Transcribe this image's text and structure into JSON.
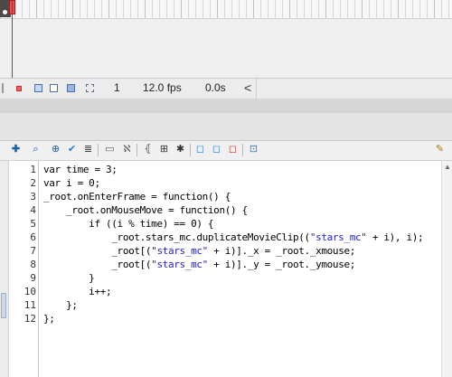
{
  "timeline": {
    "frame": "1",
    "fps": "12.0 fps",
    "time": "0.0s",
    "scroll_left": "<"
  },
  "actions": {
    "lines": [
      {
        "num": "1",
        "code": "var time = 3;"
      },
      {
        "num": "2",
        "code": "var i = 0;"
      },
      {
        "num": "3",
        "code": "_root.onEnterFrame = function() {"
      },
      {
        "num": "4",
        "code": "    _root.onMouseMove = function() {"
      },
      {
        "num": "5",
        "code": "        if ((i % time) == 0) {"
      },
      {
        "num": "6",
        "code": "            _root.stars_mc.duplicateMovieClip((\"stars_mc\" + i), i);"
      },
      {
        "num": "7",
        "code": "            _root[(\"stars_mc\" + i)]._x = _root._xmouse;"
      },
      {
        "num": "8",
        "code": "            _root[(\"stars_mc\" + i)]._y = _root._ymouse;"
      },
      {
        "num": "9",
        "code": "        }"
      },
      {
        "num": "10",
        "code": "        i++;"
      },
      {
        "num": "11",
        "code": "    };"
      },
      {
        "num": "12",
        "code": "};"
      }
    ]
  },
  "icons": {
    "toolbar": [
      "add-statement-icon",
      "find-icon",
      "target-icon",
      "check-syntax-icon",
      "auto-format-icon",
      "code-hint-icon",
      "debug-options-icon",
      "collapse-braces-icon",
      "collapse-selection-icon",
      "expand-all-icon",
      "apply-block-comment-icon",
      "apply-line-comment-icon",
      "remove-comment-icon",
      "show-hide-toolbox-icon",
      "script-assist-icon"
    ]
  }
}
